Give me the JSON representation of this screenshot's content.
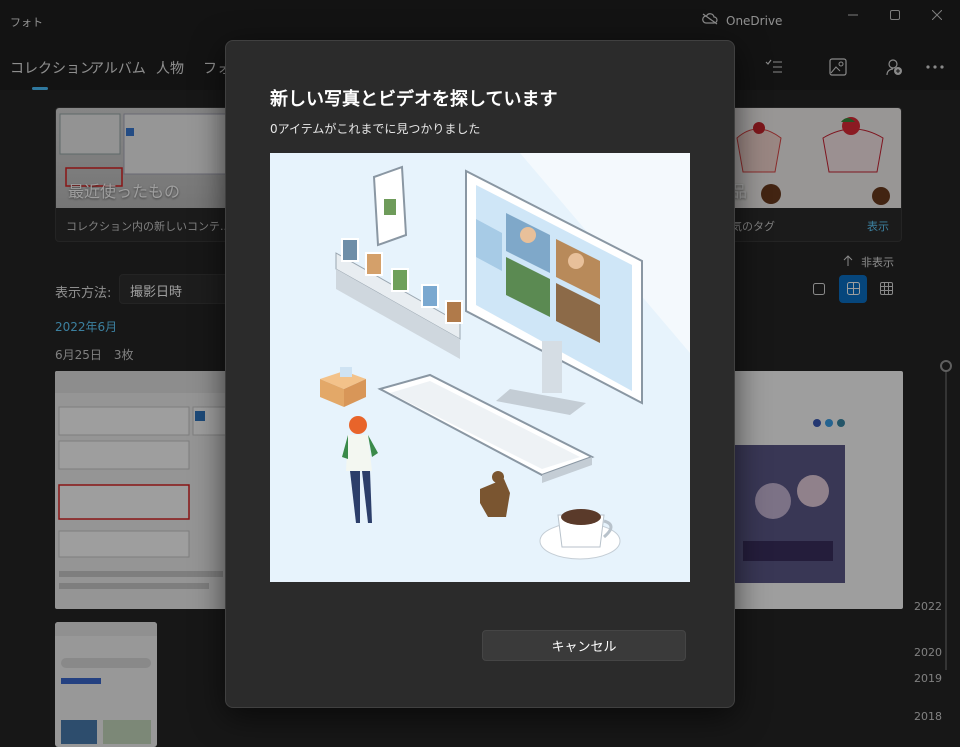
{
  "app": {
    "title": "フォト",
    "onedrive_label": "OneDrive"
  },
  "nav": {
    "tabs": [
      {
        "label": "コレクション",
        "active": true
      },
      {
        "label": "アルバム"
      },
      {
        "label": "人物"
      },
      {
        "label": "フォ"
      }
    ]
  },
  "cards": {
    "recent": {
      "overlay": "最近使ったもの",
      "caption": "コレクション内の新しいコンテ..."
    },
    "tags": {
      "overlay": "品",
      "caption": "気のタグ",
      "action": "表示"
    }
  },
  "controls": {
    "hide_label": "非表示",
    "view_by_label": "表示方法:",
    "view_by_value": "撮影日時"
  },
  "timeline": {
    "month": "2022年6月",
    "group_header": "6月25日　3枚",
    "years": [
      "2022",
      "2020",
      "2019",
      "2018"
    ]
  },
  "dialog": {
    "title": "新しい写真とビデオを探しています",
    "subtitle": "0アイテムがこれまでに見つかりました",
    "cancel_label": "キャンセル"
  },
  "colors": {
    "accent": "#4cc2ff",
    "link": "#60cdff",
    "background": "#202020",
    "dialog": "#2b2b2b"
  }
}
